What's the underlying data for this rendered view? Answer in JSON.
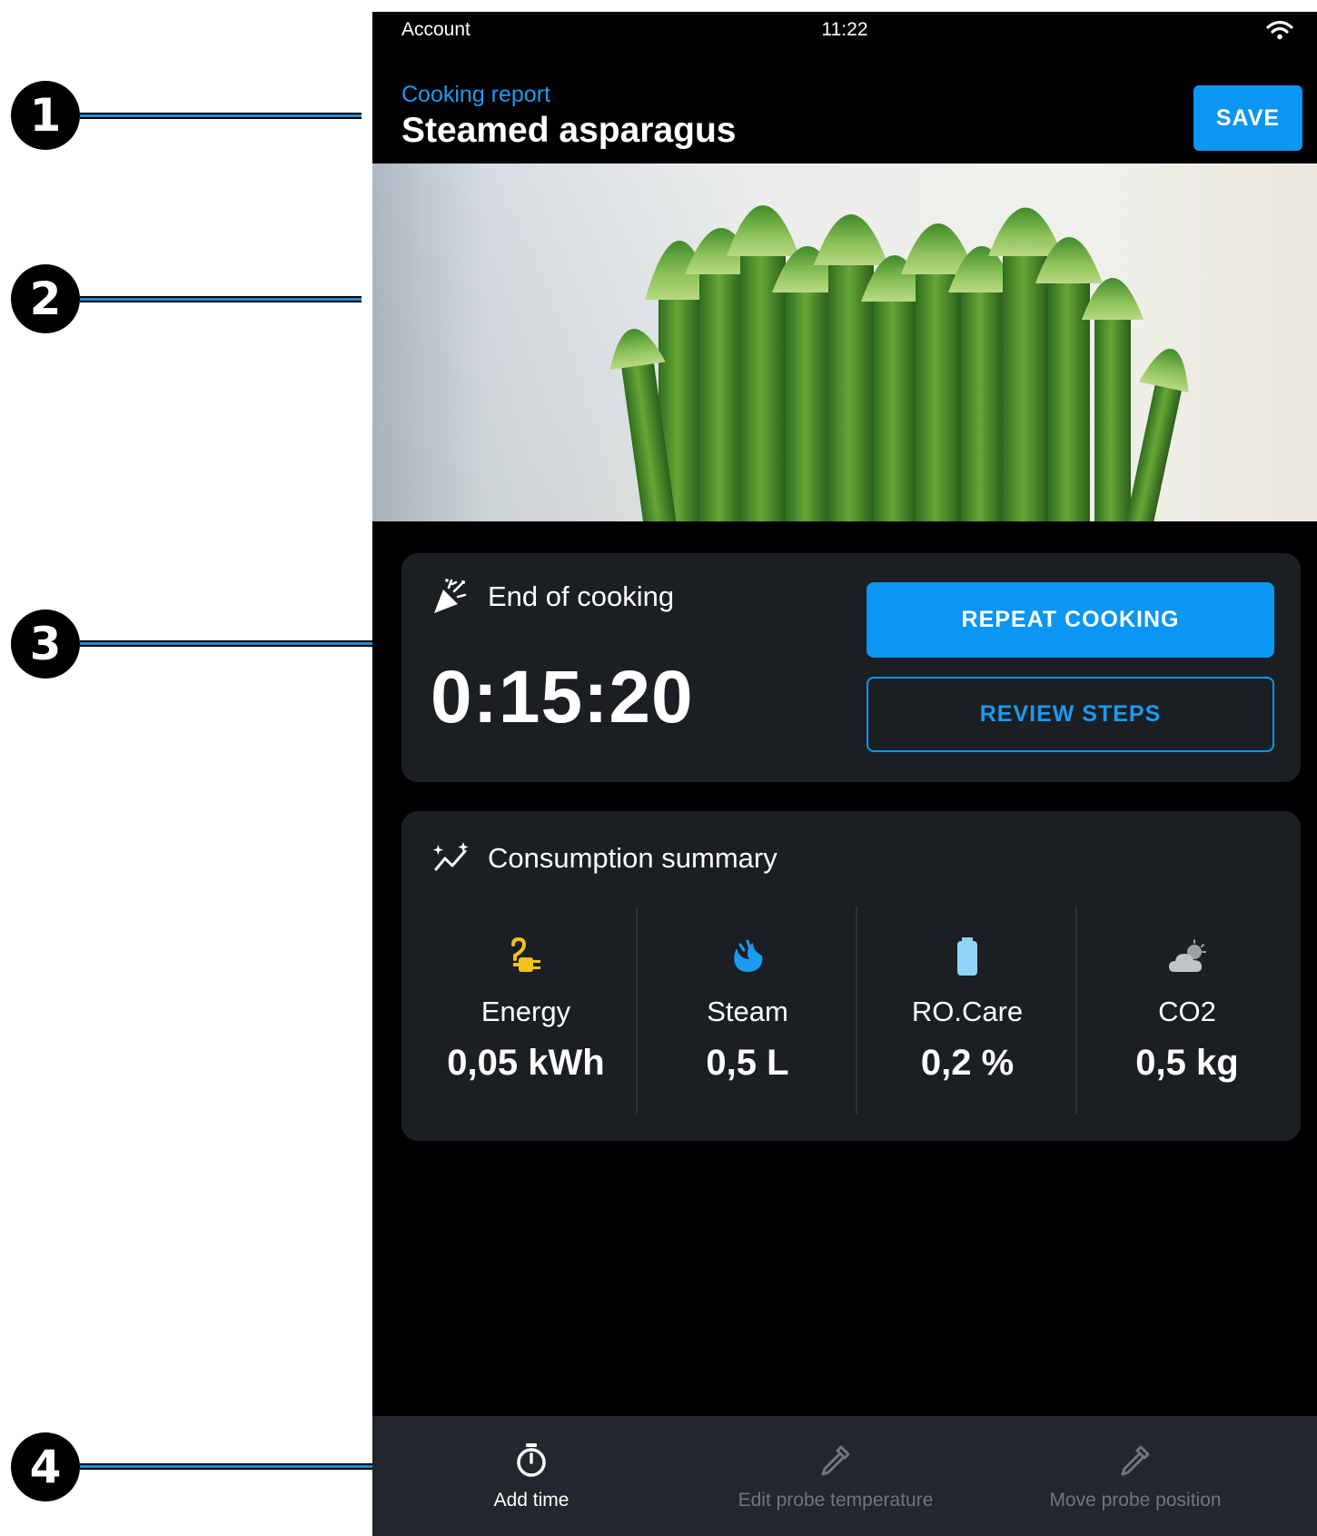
{
  "callouts": [
    "1",
    "2",
    "3",
    "4"
  ],
  "status_bar": {
    "left": "Account",
    "time": "11:22",
    "icon": "wifi-icon"
  },
  "header": {
    "subtitle": "Cooking report",
    "title": "Steamed asparagus",
    "save_label": "SAVE"
  },
  "hero": {
    "image": "asparagus-photo"
  },
  "end_of_cooking": {
    "icon": "party-popper-icon",
    "title": "End of cooking",
    "time": "0:15:20",
    "repeat_label": "REPEAT COOKING",
    "review_label": "REVIEW STEPS"
  },
  "consumption": {
    "icon": "sparkle-chart-icon",
    "title": "Consumption summary",
    "items": [
      {
        "icon": "energy-plug-icon",
        "label": "Energy",
        "value": "0,05 kWh",
        "color": "#f2c21b"
      },
      {
        "icon": "steam-icon",
        "label": "Steam",
        "value": "0,5 L",
        "color": "#1a9bf0"
      },
      {
        "icon": "battery-icon",
        "label": "RO.Care",
        "value": "0,2 %",
        "color": "#8fd3f7"
      },
      {
        "icon": "cloud-icon",
        "label": "CO2",
        "value": "0,5 kg",
        "color": "#b9bdc2"
      }
    ]
  },
  "bottom_bar": [
    {
      "icon": "timer-icon",
      "label": "Add time",
      "enabled": true
    },
    {
      "icon": "probe-icon",
      "label": "Edit probe temperature",
      "enabled": false
    },
    {
      "icon": "probe-icon",
      "label": "Move probe position",
      "enabled": false
    }
  ],
  "colors": {
    "accent": "#0a96f2",
    "card_bg": "#1b1f24",
    "bar_bg": "#22272d",
    "disabled_text": "#6f7680"
  }
}
